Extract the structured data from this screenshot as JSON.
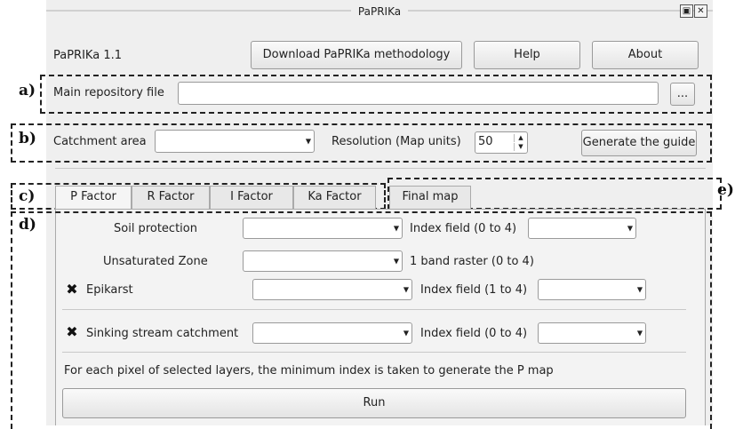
{
  "window": {
    "title": "PaPRIKa"
  },
  "header": {
    "version": "PaPRIKa 1.1",
    "download_label": "Download PaPRIKa methodology",
    "help_label": "Help",
    "about_label": "About"
  },
  "annotations": {
    "a": "a)",
    "b": "b)",
    "c": "c)",
    "d": "d)",
    "e": "e)"
  },
  "repository": {
    "label": "Main repository file",
    "value": "",
    "browse_label": "..."
  },
  "catchment": {
    "label": "Catchment area",
    "selected": "",
    "resolution_label": "Resolution (Map units)",
    "resolution_value": "50",
    "generate_label": "Generate the guide"
  },
  "tabs": [
    {
      "label": "P Factor"
    },
    {
      "label": "R Factor"
    },
    {
      "label": "I Factor"
    },
    {
      "label": "Ka Factor"
    },
    {
      "label": "Final map"
    }
  ],
  "p_factor": {
    "rows": [
      {
        "label": "Soil protection",
        "index_label": "Index field (0 to 4)"
      },
      {
        "label": "Unsaturated Zone",
        "index_label": "1 band raster (0 to 4)"
      },
      {
        "label": "Epikarst",
        "checked": true,
        "index_label": "Index field (1 to 4)"
      },
      {
        "label": "Sinking stream catchment",
        "checked": true,
        "index_label": "Index field (0 to 4)"
      }
    ],
    "note": "For each pixel of selected layers, the minimum index is taken to generate the P map",
    "run_label": "Run"
  },
  "icons": {
    "restore": "restore-icon",
    "close": "close-icon",
    "dropdown": "chevron-down-icon",
    "check": "checkbox-checked-icon"
  }
}
